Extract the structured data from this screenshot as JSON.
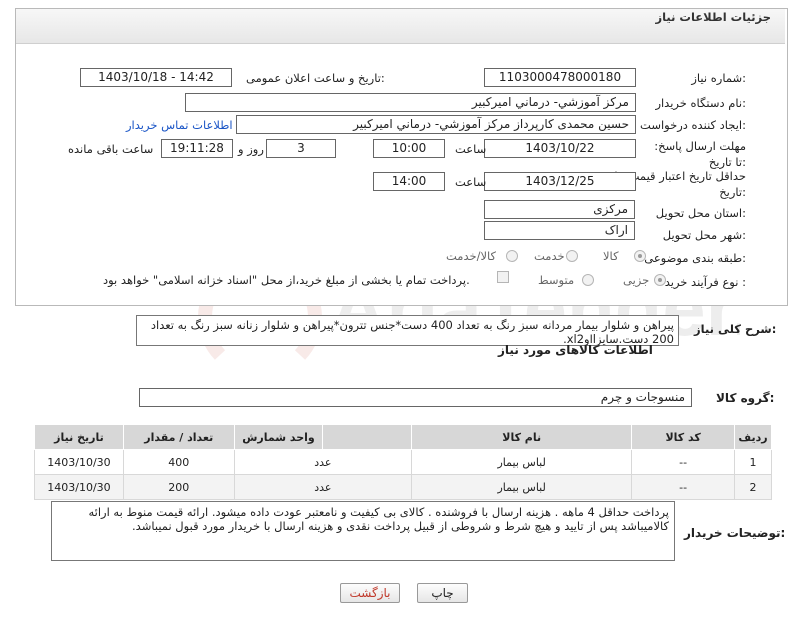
{
  "header": {
    "title": "جزئیات اطلاعات نیاز"
  },
  "fields": {
    "need_number_label": "شماره نیاز:",
    "need_number": "1103000478000180",
    "announce_label": "تاریخ و ساعت اعلان عمومی:",
    "announce_value": "1403/10/18 - 14:42",
    "buyer_org_label": "نام دستگاه خریدار:",
    "buyer_org": "مرکز آموزشي- درماني اميركبير",
    "requester_label": "ایجاد کننده درخواست:",
    "requester": "حسين  محمدی کارپرداز مرکز آموزشي- درماني اميركبير",
    "contact_link": "اطلاعات تماس خریدار",
    "deadline_label": "مهلت ارسال پاسخ: تا تاریخ:",
    "deadline_date": "1403/10/22",
    "time_label": "ساعت",
    "deadline_time": "10:00",
    "days_value": "3",
    "days_label": "روز و",
    "remaining_time": "19:11:28",
    "remaining_label": "ساعت باقی مانده",
    "validity_label": "حداقل تاریخ اعتبار قیمت: تا تاریخ:",
    "validity_date": "1403/12/25",
    "validity_time": "14:00",
    "province_label": "استان محل تحویل:",
    "province": "مرکزی",
    "city_label": "شهر محل تحویل:",
    "city": "اراک",
    "category_label": "طبقه بندی موضوعی:",
    "category_options": [
      "کالا",
      "خدمت",
      "کالا/خدمت"
    ],
    "purchase_type_label": "نوع فرآیند خرید :",
    "purchase_type_options": [
      "جزیی",
      "متوسط"
    ],
    "payment_note": "پرداخت تمام یا بخشی از مبلغ خرید،از محل \"اسناد خزانه اسلامی\" خواهد بود."
  },
  "description": {
    "label": "شرح کلی نیاز:",
    "text": "پیراهن و شلوار بیمار مردانه سبز رنگ به تعداد 400 دست*جنس تترون*پیراهن و شلوار زنانه سبز رنگ به تعداد 200 دست.سایزlاوxl2."
  },
  "goods": {
    "section_title": "اطلاعات کالاهای مورد نیاز",
    "group_label": "گروه کالا:",
    "group_value": "منسوجات و چرم",
    "columns": [
      "ردیف",
      "کد کالا",
      "نام کالا",
      "واحد شمارش",
      "تعداد / مقدار",
      "تاریخ نیاز"
    ],
    "rows": [
      {
        "row": "1",
        "code": "--",
        "name": "لباس بیمار",
        "unit": "عدد",
        "qty": "400",
        "date": "1403/10/30"
      },
      {
        "row": "2",
        "code": "--",
        "name": "لباس بیمار",
        "unit": "عدد",
        "qty": "200",
        "date": "1403/10/30"
      }
    ]
  },
  "buyer_notes": {
    "label": "توضیحات خریدار:",
    "text": "پرداخت حداقل 4 ماهه . هزینه ارسال با فروشنده .  کالای بی کیفیت و نامعتبر عودت داده میشود. ارائه قیمت منوط به ارائه کالامیباشد پس از تایید و هیچ شرط و شروطی از قبیل پرداخت نقدی و هزینه ارسال با خریدار مورد قبول نمیباشد."
  },
  "buttons": {
    "print": "چاپ",
    "back": "بازگشت"
  },
  "watermark": {
    "text": "AriaTender.neT"
  },
  "colors": {
    "link": "#1a55c6",
    "watermark": "#c0392b"
  }
}
